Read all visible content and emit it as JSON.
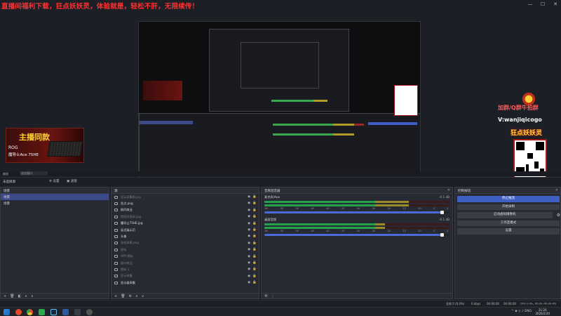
{
  "banner": "直播间福利下载，狂点妖妖灵，体验就是，轻松不肝，无限续传！",
  "window_controls": {
    "minimize": "—",
    "maximize": "☐",
    "close": "✕"
  },
  "rog_ad": {
    "title": "主播同款",
    "brand": "ROG",
    "model": "魔导士Ace 75HE"
  },
  "promo": {
    "group": "加群/Q群牛拍群",
    "wechat": "V:wanjiqicogo",
    "logo": "狂点妖妖灵"
  },
  "preview_toolbar": {
    "zoom": "缩放",
    "zoom_value": "适应窗口"
  },
  "scene_row": {
    "scene": "未选择源",
    "settings": "⚙ 设置",
    "filters": "▣ 滤镜"
  },
  "scenes": {
    "title": "场景",
    "items": [
      {
        "label": "场景",
        "active": true
      },
      {
        "label": "场景",
        "active": false
      }
    ]
  },
  "sources": {
    "title": "源",
    "items": [
      {
        "label": "显示采集图.jpg",
        "dim": true
      },
      {
        "label": "花点.png",
        "dim": false
      },
      {
        "label": "顾问商业",
        "dim": false
      },
      {
        "label": "提网页图录.jpg",
        "dim": true
      },
      {
        "label": "魔导士75HE.jpg",
        "dim": false
      },
      {
        "label": "延迟展示页",
        "dim": false
      },
      {
        "label": "头像",
        "dim": false
      },
      {
        "label": "游戏采集.png",
        "dim": true
      },
      {
        "label": "图标",
        "dim": true
      },
      {
        "label": "APP 图标",
        "dim": true
      },
      {
        "label": "窗口商品",
        "dim": true
      },
      {
        "label": "图标 1",
        "dim": true
      },
      {
        "label": "显示采集",
        "dim": true
      },
      {
        "label": "显示器采集",
        "dim": false
      }
    ]
  },
  "mixer": {
    "title": "音频混音器",
    "tracks": [
      {
        "name": "麦克风/Aux",
        "db": "-0.1 dB",
        "level": 0.78,
        "fader": 0.97
      },
      {
        "name": "桌面音频",
        "db": "-0.1 dB",
        "level": 0.65,
        "fader": 0.97
      }
    ],
    "scale": [
      "-60",
      "-55",
      "-50",
      "-45",
      "-40",
      "-35",
      "-30",
      "-25",
      "-20",
      "-15",
      "-10",
      "-5",
      "0"
    ]
  },
  "controls": {
    "title": "控制按钮",
    "stop_stream": "停止推流",
    "start_record": "开始录制",
    "virtual_cam": "启动虚拟摄像机",
    "studio_mode": "工作室模式",
    "settings": "设置"
  },
  "status": {
    "dropped": "丢帧 0 (0.0%)",
    "bitrate": "0 kbps",
    "stream_time": "00:00:00",
    "rec_time": "00:00:00",
    "cpu": "CPU: 0.9%，60.00 / 60.00 FPS"
  },
  "taskbar": {
    "time": "21:20",
    "date": "2026/2/20",
    "lang": "ENG"
  }
}
